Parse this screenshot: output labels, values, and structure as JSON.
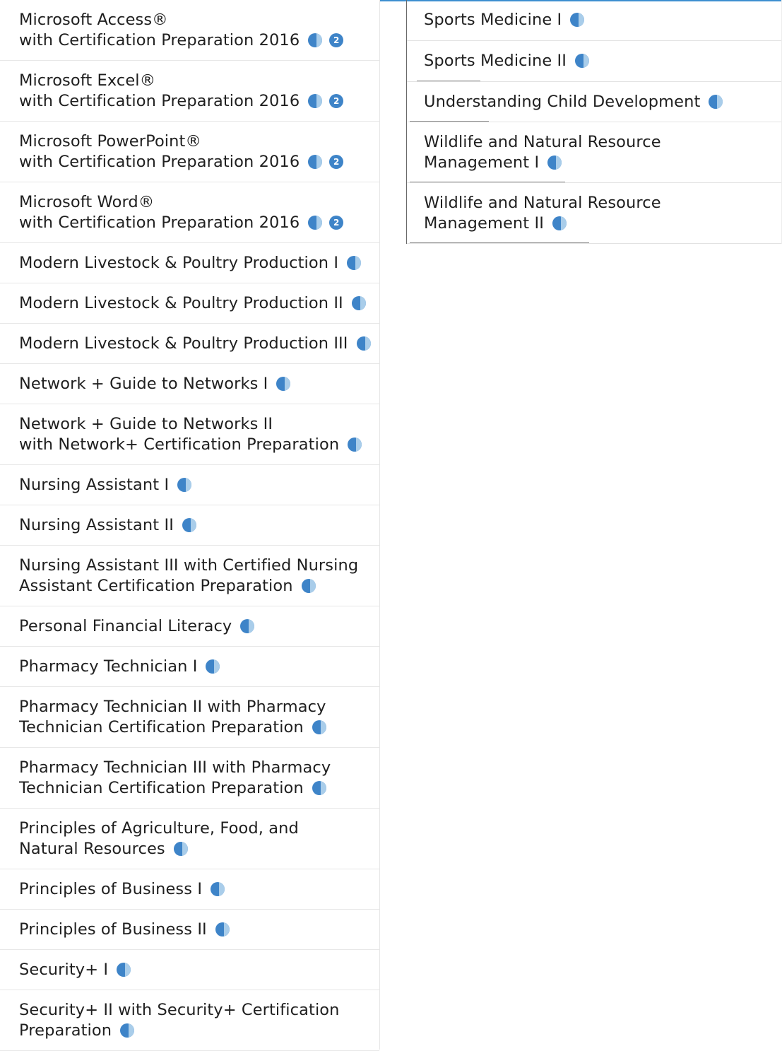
{
  "left_column": [
    {
      "line1": "Microsoft Access®",
      "line2": "with Certification Preparation 2016",
      "icons": [
        "half-circle-icon",
        "number-badge-icon"
      ],
      "badge": "2"
    },
    {
      "line1": "Microsoft Excel®",
      "line2": "with Certification Preparation 2016",
      "icons": [
        "half-circle-icon",
        "number-badge-icon"
      ],
      "badge": "2"
    },
    {
      "line1": "Microsoft PowerPoint®",
      "line2": "with Certification Preparation 2016",
      "icons": [
        "half-circle-icon",
        "number-badge-icon"
      ],
      "badge": "2"
    },
    {
      "line1": "Microsoft Word®",
      "line2": "with Certification Preparation 2016",
      "icons": [
        "half-circle-icon",
        "number-badge-icon"
      ],
      "badge": "2"
    },
    {
      "line1": "Modern Livestock & Poultry Production I",
      "icons": [
        "half-circle-icon"
      ]
    },
    {
      "line1": "Modern Livestock & Poultry Production II",
      "icons": [
        "half-circle-icon"
      ]
    },
    {
      "line1": "Modern Livestock & Poultry Production III",
      "icons": [
        "half-circle-icon"
      ]
    },
    {
      "line1": "Network + Guide to Networks I",
      "icons": [
        "half-circle-icon"
      ]
    },
    {
      "line1": "Network + Guide to Networks II",
      "line2": "with Network+ Certification Preparation",
      "icons": [
        "half-circle-icon"
      ]
    },
    {
      "line1": "Nursing Assistant I",
      "icons": [
        "half-circle-icon"
      ]
    },
    {
      "line1": "Nursing Assistant II",
      "icons": [
        "half-circle-icon"
      ]
    },
    {
      "line1": "Nursing Assistant III with Certified Nursing",
      "line2": "Assistant Certification Preparation",
      "icons": [
        "half-circle-icon"
      ]
    },
    {
      "line1": "Personal Financial Literacy",
      "icons": [
        "half-circle-icon"
      ]
    },
    {
      "line1": "Pharmacy Technician I",
      "icons": [
        "half-circle-icon"
      ]
    },
    {
      "line1": "Pharmacy Technician II with Pharmacy",
      "line2": "Technician Certification Preparation",
      "icons": [
        "half-circle-icon"
      ]
    },
    {
      "line1": "Pharmacy Technician III with Pharmacy",
      "line2": "Technician Certification Preparation",
      "icons": [
        "half-circle-icon"
      ]
    },
    {
      "line1": "Principles of Agriculture, Food, and",
      "line2": "Natural Resources",
      "icons": [
        "half-circle-icon"
      ]
    },
    {
      "line1": "Principles of Business I",
      "icons": [
        "half-circle-icon"
      ]
    },
    {
      "line1": "Principles of Business II",
      "icons": [
        "half-circle-icon"
      ]
    },
    {
      "line1": "Security+ I",
      "icons": [
        "half-circle-icon"
      ]
    },
    {
      "line1": "Security+ II with Security+ Certification",
      "line2": "Preparation",
      "icons": [
        "half-circle-icon"
      ]
    }
  ],
  "right_column": [
    {
      "line1": "Sports Medicine I",
      "icons": [
        "half-circle-icon"
      ]
    },
    {
      "line1": "Sports Medicine II",
      "icons": [
        "half-circle-icon"
      ]
    },
    {
      "line1": "Understanding Child Development",
      "icons": [
        "half-circle-icon"
      ]
    },
    {
      "line1": "Wildlife and Natural Resource",
      "line2": "Management I",
      "icons": [
        "half-circle-icon"
      ]
    },
    {
      "line1": "Wildlife and Natural Resource",
      "line2": "Management II",
      "icons": [
        "half-circle-icon"
      ]
    }
  ],
  "colors": {
    "accent": "#3e84c8",
    "accent_light": "#a9cdea",
    "rule": "#e7e7e7",
    "text": "#1f1f1f"
  }
}
